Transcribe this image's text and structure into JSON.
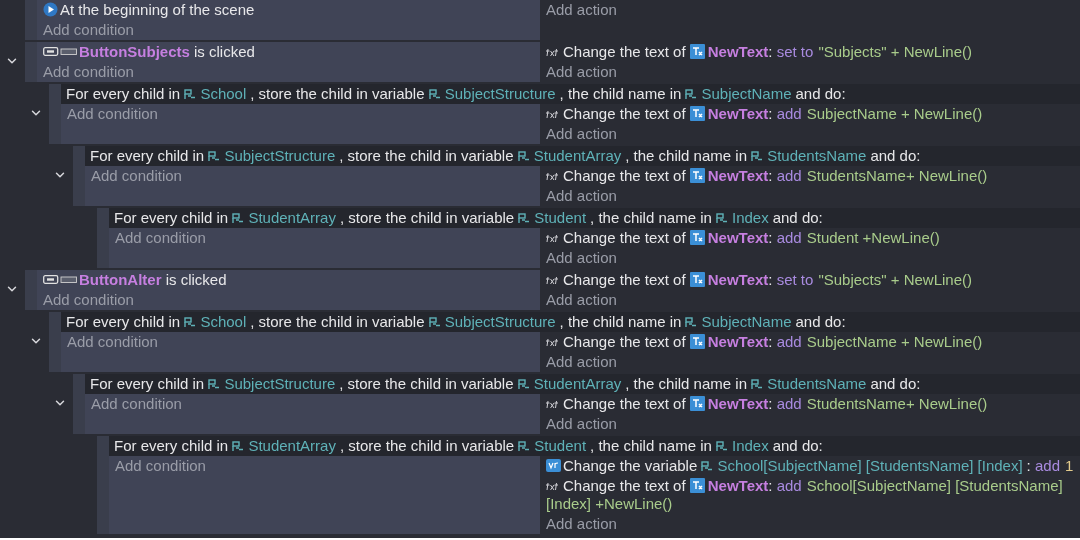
{
  "events": [
    {
      "kind": "standard",
      "conditions": [
        {
          "kind": "scene-start",
          "parts": [
            {
              "kind": "plain",
              "text": "At the beginning of the scene"
            }
          ]
        }
      ],
      "add_condition": "Add condition",
      "add_action": "Add action"
    },
    {
      "kind": "standard",
      "expanded": true,
      "conditions": [
        {
          "kind": "button-click",
          "parts": [
            {
              "kind": "object",
              "text": "ButtonSubjects"
            },
            {
              "kind": "plain",
              "text": " is clicked"
            }
          ]
        }
      ],
      "add_condition": "Add condition",
      "actions": [
        {
          "kind": "text",
          "parts": [
            {
              "kind": "plain",
              "text": "Change the text of "
            },
            {
              "kind": "text-object",
              "text": "NewText"
            },
            {
              "kind": "plain",
              "text": ": "
            },
            {
              "kind": "keyword",
              "text": "set to"
            },
            {
              "kind": "value",
              "text": "\"Subjects\" + NewLine()"
            }
          ]
        }
      ],
      "add_action": "Add action",
      "children": [
        {
          "kind": "for-each",
          "expanded": true,
          "header": [
            {
              "kind": "plain",
              "text": "For every child in "
            },
            {
              "kind": "variable",
              "text": "School"
            },
            {
              "kind": "plain",
              "text": ", store the child in variable "
            },
            {
              "kind": "variable",
              "text": "SubjectStructure"
            },
            {
              "kind": "plain",
              "text": ", the child name in "
            },
            {
              "kind": "variable",
              "text": "SubjectName"
            },
            {
              "kind": "plain",
              "text": "and do:"
            }
          ],
          "add_condition": "Add condition",
          "actions": [
            {
              "kind": "text",
              "parts": [
                {
                  "kind": "plain",
                  "text": "Change the text of "
                },
                {
                  "kind": "text-object",
                  "text": "NewText"
                },
                {
                  "kind": "plain",
                  "text": ": "
                },
                {
                  "kind": "keyword",
                  "text": "add"
                },
                {
                  "kind": "value",
                  "text": "SubjectName + NewLine()"
                }
              ]
            }
          ],
          "add_action": "Add action",
          "children": [
            {
              "kind": "for-each",
              "expanded": true,
              "header": [
                {
                  "kind": "plain",
                  "text": "For every child in "
                },
                {
                  "kind": "variable",
                  "text": "SubjectStructure"
                },
                {
                  "kind": "plain",
                  "text": ", store the child in variable "
                },
                {
                  "kind": "variable",
                  "text": "StudentArray"
                },
                {
                  "kind": "plain",
                  "text": ", the child name in "
                },
                {
                  "kind": "variable",
                  "text": "StudentsName"
                },
                {
                  "kind": "plain",
                  "text": "and do:"
                }
              ],
              "add_condition": "Add condition",
              "actions": [
                {
                  "kind": "text",
                  "parts": [
                    {
                      "kind": "plain",
                      "text": "Change the text of "
                    },
                    {
                      "kind": "text-object",
                      "text": "NewText"
                    },
                    {
                      "kind": "plain",
                      "text": ": "
                    },
                    {
                      "kind": "keyword",
                      "text": "add"
                    },
                    {
                      "kind": "value",
                      "text": "StudentsName+ NewLine()"
                    }
                  ]
                }
              ],
              "add_action": "Add action",
              "children": [
                {
                  "kind": "for-each",
                  "header": [
                    {
                      "kind": "plain",
                      "text": "For every child in "
                    },
                    {
                      "kind": "variable",
                      "text": "StudentArray"
                    },
                    {
                      "kind": "plain",
                      "text": ", store the child in variable "
                    },
                    {
                      "kind": "variable",
                      "text": "Student"
                    },
                    {
                      "kind": "plain",
                      "text": ", the child name in "
                    },
                    {
                      "kind": "variable",
                      "text": "Index"
                    },
                    {
                      "kind": "plain",
                      "text": "and do:"
                    }
                  ],
                  "add_condition": "Add condition",
                  "actions": [
                    {
                      "kind": "text",
                      "parts": [
                        {
                          "kind": "plain",
                          "text": "Change the text of "
                        },
                        {
                          "kind": "text-object",
                          "text": "NewText"
                        },
                        {
                          "kind": "plain",
                          "text": ": "
                        },
                        {
                          "kind": "keyword",
                          "text": "add"
                        },
                        {
                          "kind": "value",
                          "text": "Student +NewLine()"
                        }
                      ]
                    }
                  ],
                  "add_action": "Add action"
                }
              ]
            }
          ]
        }
      ]
    },
    {
      "kind": "standard",
      "expanded": true,
      "conditions": [
        {
          "kind": "button-click",
          "parts": [
            {
              "kind": "object",
              "text": "ButtonAlter"
            },
            {
              "kind": "plain",
              "text": " is clicked"
            }
          ]
        }
      ],
      "add_condition": "Add condition",
      "actions": [
        {
          "kind": "text",
          "parts": [
            {
              "kind": "plain",
              "text": "Change the text of "
            },
            {
              "kind": "text-object",
              "text": "NewText"
            },
            {
              "kind": "plain",
              "text": ": "
            },
            {
              "kind": "keyword",
              "text": "set to"
            },
            {
              "kind": "value",
              "text": "\"Subjects\" + NewLine()"
            }
          ]
        }
      ],
      "add_action": "Add action",
      "children": [
        {
          "kind": "for-each",
          "expanded": true,
          "header": [
            {
              "kind": "plain",
              "text": "For every child in "
            },
            {
              "kind": "variable",
              "text": "School"
            },
            {
              "kind": "plain",
              "text": ", store the child in variable "
            },
            {
              "kind": "variable",
              "text": "SubjectStructure"
            },
            {
              "kind": "plain",
              "text": ", the child name in "
            },
            {
              "kind": "variable",
              "text": "SubjectName"
            },
            {
              "kind": "plain",
              "text": "and do:"
            }
          ],
          "add_condition": "Add condition",
          "actions": [
            {
              "kind": "text",
              "parts": [
                {
                  "kind": "plain",
                  "text": "Change the text of "
                },
                {
                  "kind": "text-object",
                  "text": "NewText"
                },
                {
                  "kind": "plain",
                  "text": ": "
                },
                {
                  "kind": "keyword",
                  "text": "add"
                },
                {
                  "kind": "value",
                  "text": "SubjectName + NewLine()"
                }
              ]
            }
          ],
          "add_action": "Add action",
          "children": [
            {
              "kind": "for-each",
              "expanded": true,
              "header": [
                {
                  "kind": "plain",
                  "text": "For every child in "
                },
                {
                  "kind": "variable",
                  "text": "SubjectStructure"
                },
                {
                  "kind": "plain",
                  "text": ", store the child in variable "
                },
                {
                  "kind": "variable",
                  "text": "StudentArray"
                },
                {
                  "kind": "plain",
                  "text": ", the child name in "
                },
                {
                  "kind": "variable",
                  "text": "StudentsName"
                },
                {
                  "kind": "plain",
                  "text": "and do:"
                }
              ],
              "add_condition": "Add condition",
              "actions": [
                {
                  "kind": "text",
                  "parts": [
                    {
                      "kind": "plain",
                      "text": "Change the text of "
                    },
                    {
                      "kind": "text-object",
                      "text": "NewText"
                    },
                    {
                      "kind": "plain",
                      "text": ": "
                    },
                    {
                      "kind": "keyword",
                      "text": "add"
                    },
                    {
                      "kind": "value",
                      "text": "StudentsName+ NewLine()"
                    }
                  ]
                }
              ],
              "add_action": "Add action",
              "children": [
                {
                  "kind": "for-each",
                  "header": [
                    {
                      "kind": "plain",
                      "text": "For every child in "
                    },
                    {
                      "kind": "variable",
                      "text": "StudentArray"
                    },
                    {
                      "kind": "plain",
                      "text": ", store the child in variable "
                    },
                    {
                      "kind": "variable",
                      "text": "Student"
                    },
                    {
                      "kind": "plain",
                      "text": ", the child name in "
                    },
                    {
                      "kind": "variable",
                      "text": "Index"
                    },
                    {
                      "kind": "plain",
                      "text": "and do:"
                    }
                  ],
                  "add_condition": "Add condition",
                  "actions": [
                    {
                      "kind": "variable",
                      "parts": [
                        {
                          "kind": "plain",
                          "text": "Change the variable "
                        },
                        {
                          "kind": "variable",
                          "text": "School[SubjectName] [StudentsName] [Index]"
                        },
                        {
                          "kind": "plain",
                          "text": ": "
                        },
                        {
                          "kind": "keyword",
                          "text": "add"
                        },
                        {
                          "kind": "number",
                          "text": "1"
                        }
                      ]
                    },
                    {
                      "kind": "text",
                      "parts": [
                        {
                          "kind": "plain",
                          "text": "Change the text of "
                        },
                        {
                          "kind": "text-object",
                          "text": "NewText"
                        },
                        {
                          "kind": "plain",
                          "text": ": "
                        },
                        {
                          "kind": "keyword",
                          "text": "add"
                        },
                        {
                          "kind": "value",
                          "text": "School[SubjectName] [StudentsName] [Index] +NewLine()"
                        }
                      ]
                    }
                  ],
                  "add_action": "Add action"
                }
              ]
            }
          ]
        }
      ]
    }
  ]
}
